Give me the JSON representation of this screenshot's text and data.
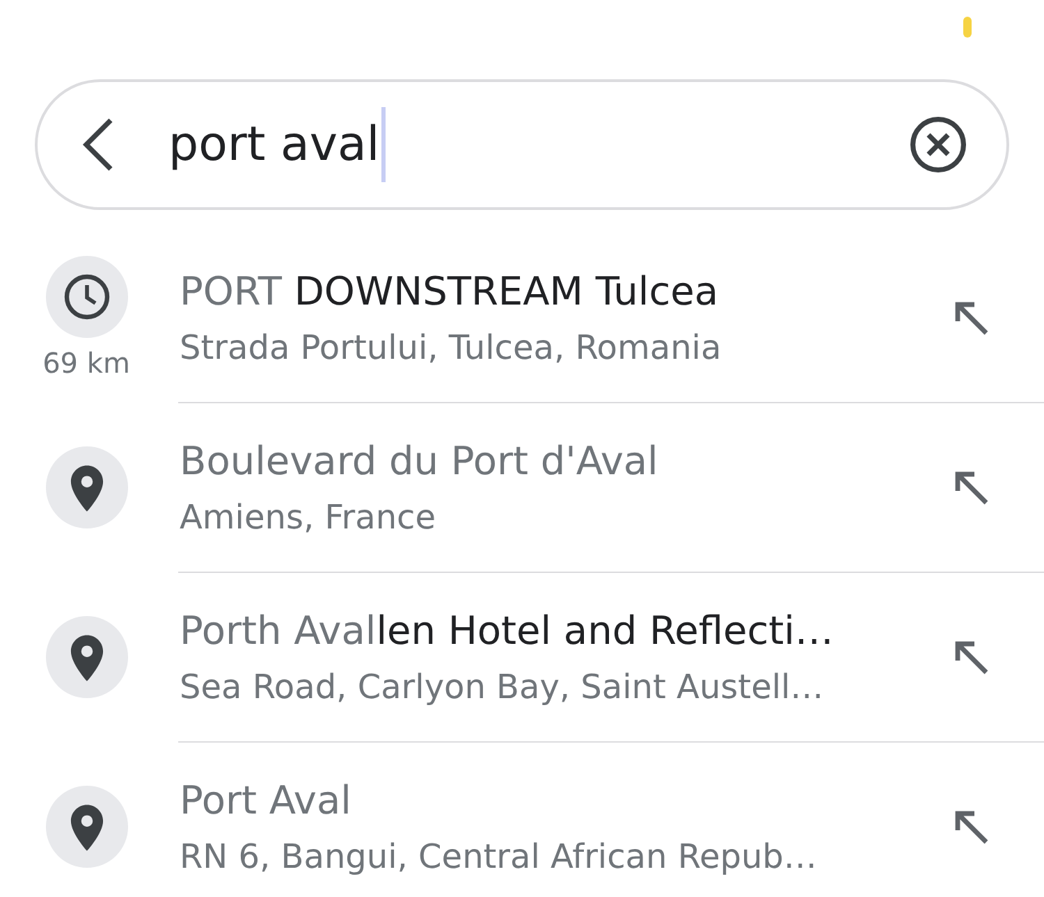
{
  "status_bar": {
    "privacy_indicator": true
  },
  "search": {
    "value": "port aval",
    "focused": true
  },
  "suggestions": [
    {
      "kind": "recent",
      "distance": "69 km",
      "title": [
        {
          "text": "PORT",
          "matched": true
        },
        {
          "text": " DOWNSTREAM Tulcea",
          "matched": false
        }
      ],
      "subtitle": "Strada Portului, Tulcea, Romania"
    },
    {
      "kind": "place",
      "title": [
        {
          "text": "Boulevard du Port d'Aval",
          "matched": true
        }
      ],
      "subtitle": "Amiens, France"
    },
    {
      "kind": "place",
      "title": [
        {
          "text": "Porth Aval",
          "matched": true
        },
        {
          "text": "len Hotel and Reflecti…",
          "matched": false
        }
      ],
      "subtitle": "Sea Road, Carlyon Bay, Saint Austell…"
    },
    {
      "kind": "place",
      "title": [
        {
          "text": "Port Aval",
          "matched": true
        }
      ],
      "subtitle": "RN 6, Bangui, Central African Repub…"
    }
  ]
}
